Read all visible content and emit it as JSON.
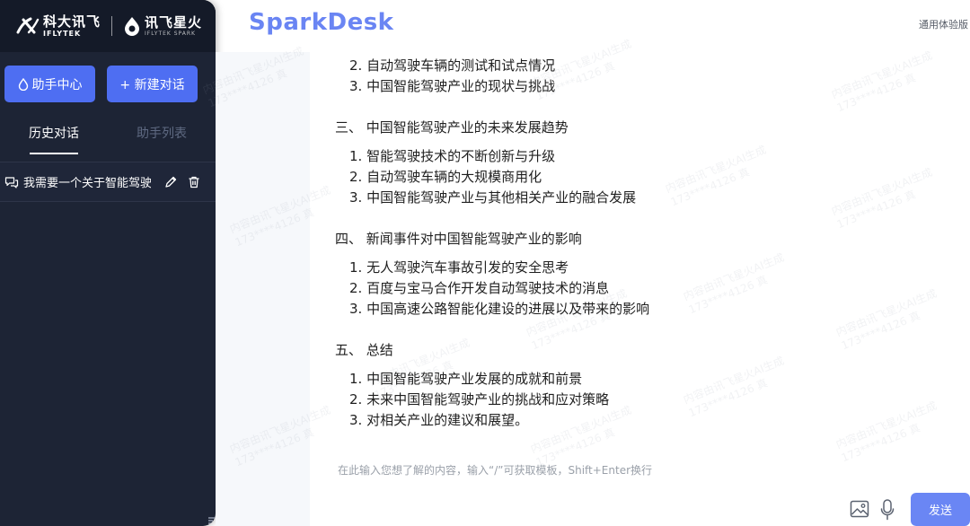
{
  "brand": {
    "company_cn": "科大讯飞",
    "company_en": "IFLYTEK",
    "product_cn": "讯飞星火",
    "product_en": "IFLYTEK SPARK"
  },
  "sidebar": {
    "buttons": {
      "assistant_center": "助手中心",
      "new_chat": "+ 新建对话"
    },
    "tabs": [
      {
        "label": "历史对话",
        "active": true
      },
      {
        "label": "助手列表",
        "active": false
      }
    ],
    "conversations": [
      {
        "title": "我需要一个关于智能驾驶"
      }
    ]
  },
  "header": {
    "logo": "SparkDesk",
    "version": "通用体验版"
  },
  "answer": [
    {
      "type": "item",
      "text": "2. 自动驾驶车辆的测试和试点情况"
    },
    {
      "type": "item",
      "text": "3. 中国智能驾驶产业的现状与挑战"
    },
    {
      "type": "section",
      "text": "三、 中国智能驾驶产业的未来发展趋势"
    },
    {
      "type": "item",
      "text": "1. 智能驾驶技术的不断创新与升级"
    },
    {
      "type": "item",
      "text": "2. 自动驾驶车辆的大规模商用化"
    },
    {
      "type": "item",
      "text": "3. 中国智能驾驶产业与其他相关产业的融合发展"
    },
    {
      "type": "section",
      "text": "四、 新闻事件对中国智能驾驶产业的影响"
    },
    {
      "type": "item",
      "text": "1. 无人驾驶汽车事故引发的安全思考"
    },
    {
      "type": "item",
      "text": "2. 百度与宝马合作开发自动驾驶技术的消息"
    },
    {
      "type": "item",
      "text": "3. 中国高速公路智能化建设的进展以及带来的影响"
    },
    {
      "type": "section",
      "text": "五、 总结"
    },
    {
      "type": "item",
      "text": "1. 中国智能驾驶产业发展的成就和前景"
    },
    {
      "type": "item",
      "text": "2. 未来中国智能驾驶产业的挑战和应对策略"
    },
    {
      "type": "item",
      "text": "3. 对相关产业的建议和展望。"
    }
  ],
  "watermark": {
    "line1": "内容由讯飞星火AI生成",
    "line2": "173****4126 真"
  },
  "input": {
    "value": "",
    "placeholder": "在此输入您想了解的内容，输入“/”可获取模板，Shift+Enter换行"
  },
  "send_label": "发送",
  "colors": {
    "sidebar_bg": "#1d2435",
    "accent": "#4e6ef2",
    "logo": "#6a85f3"
  }
}
